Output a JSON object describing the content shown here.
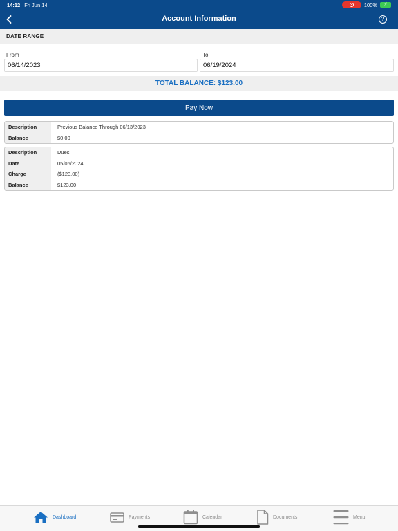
{
  "status_bar": {
    "time": "14:12",
    "date": "Fri Jun 14",
    "battery": "100%"
  },
  "header": {
    "title": "Account Information",
    "help_icon": "help-icon",
    "back_icon": "chevron-left-icon"
  },
  "date_range": {
    "heading": "DATE RANGE",
    "from_label": "From",
    "from_value": "06/14/2023",
    "to_label": "To",
    "to_value": "06/19/2024"
  },
  "total_balance": "TOTAL BALANCE: $123.00",
  "pay_button": "Pay Now",
  "cards": [
    {
      "rows": [
        {
          "key": "Description",
          "value": "Previous Balance Through 06/13/2023"
        },
        {
          "key": "Balance",
          "value": "$0.00"
        }
      ]
    },
    {
      "rows": [
        {
          "key": "Description",
          "value": "Dues"
        },
        {
          "key": "Date",
          "value": "05/06/2024"
        },
        {
          "key": "Charge",
          "value": "($123.00)"
        },
        {
          "key": "Balance",
          "value": "$123.00"
        }
      ]
    }
  ],
  "tabs": [
    {
      "label": "Dashboard",
      "icon": "home-icon",
      "active": true
    },
    {
      "label": "Payments",
      "icon": "credit-card-icon",
      "active": false
    },
    {
      "label": "Calendar",
      "icon": "calendar-icon",
      "active": false
    },
    {
      "label": "Documents",
      "icon": "document-icon",
      "active": false
    },
    {
      "label": "Menu",
      "icon": "menu-icon",
      "active": false
    }
  ],
  "colors": {
    "primary": "#0b4a8b",
    "accent": "#1a6fc2",
    "inactive": "#8e8e8e"
  }
}
